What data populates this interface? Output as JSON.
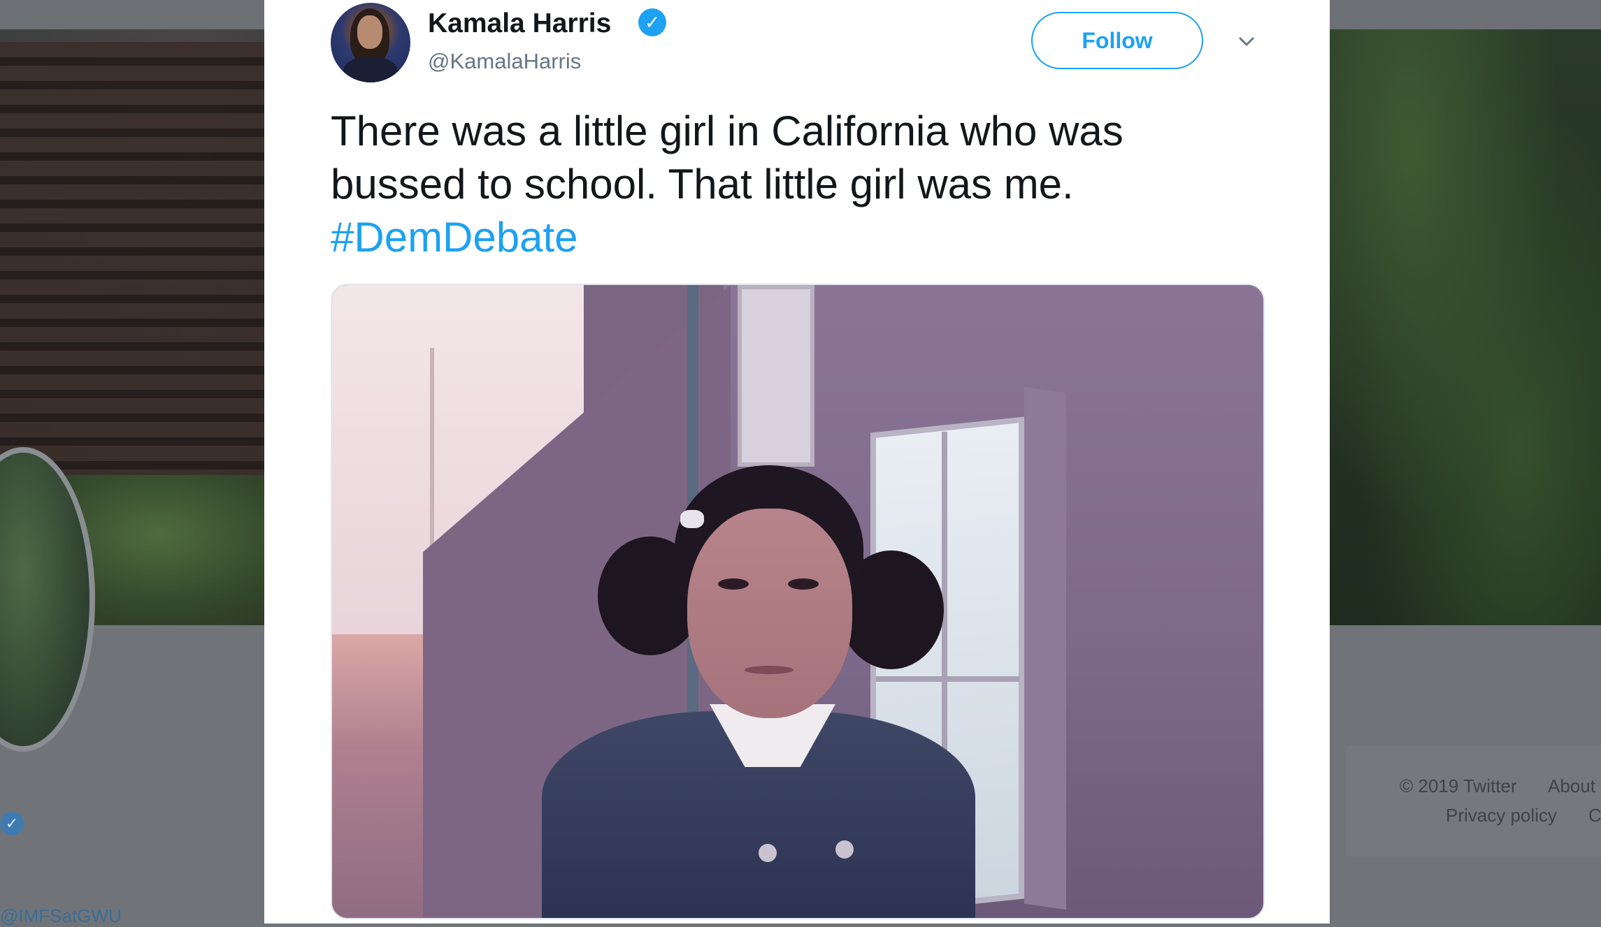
{
  "background": {
    "mention_text": "@IMFSatGWU",
    "footer": {
      "copyright": "© 2019 Twitter",
      "about": "About",
      "privacy": "Privacy policy",
      "more": "C"
    },
    "verified_glyph": "✓"
  },
  "tweet": {
    "author": {
      "display_name": "Kamala Harris",
      "handle": "@KamalaHarris",
      "verified_glyph": "✓"
    },
    "follow_label": "Follow",
    "text_line1": "There was a little girl in California who was",
    "text_line2": "bussed to school. That little girl was me.",
    "hashtag": "#DemDebate",
    "menu_icon": "chevron-down-icon"
  },
  "colors": {
    "accent": "#1da1f2",
    "text": "#14171a",
    "secondary": "#657786"
  }
}
